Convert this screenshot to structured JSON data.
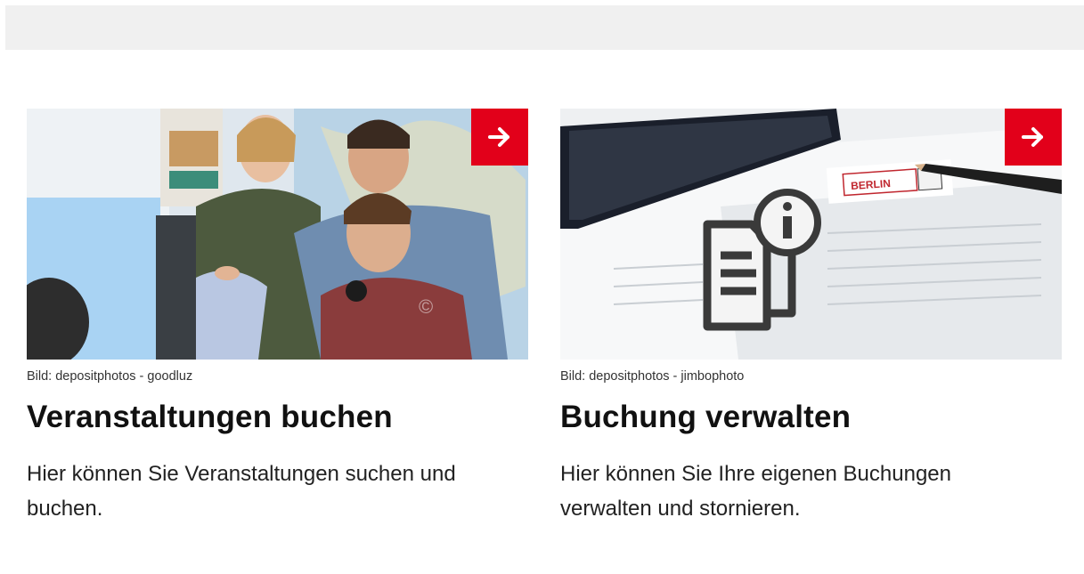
{
  "cards": [
    {
      "image_alt": "Gruppe junger Menschen am Computer",
      "credit": "Bild: depositphotos - goodluz",
      "title": "Veranstaltungen buchen",
      "text": "Hier können Sie Veranstaltungen suchen und buchen.",
      "watermark": "©",
      "arrow_icon": "arrow-right-icon"
    },
    {
      "image_alt": "Dokumente mit Info-Symbol und Berlin-Stempel",
      "credit": "Bild: depositphotos - jimbophoto",
      "title": "Buchung verwalten",
      "text": "Hier können Sie Ihre eigenen Buchungen verwalten und stornieren.",
      "stamp_text": "BERLIN",
      "arrow_icon": "arrow-right-icon"
    }
  ],
  "colors": {
    "accent": "#e2001a",
    "topbar": "#f0f0f0"
  }
}
